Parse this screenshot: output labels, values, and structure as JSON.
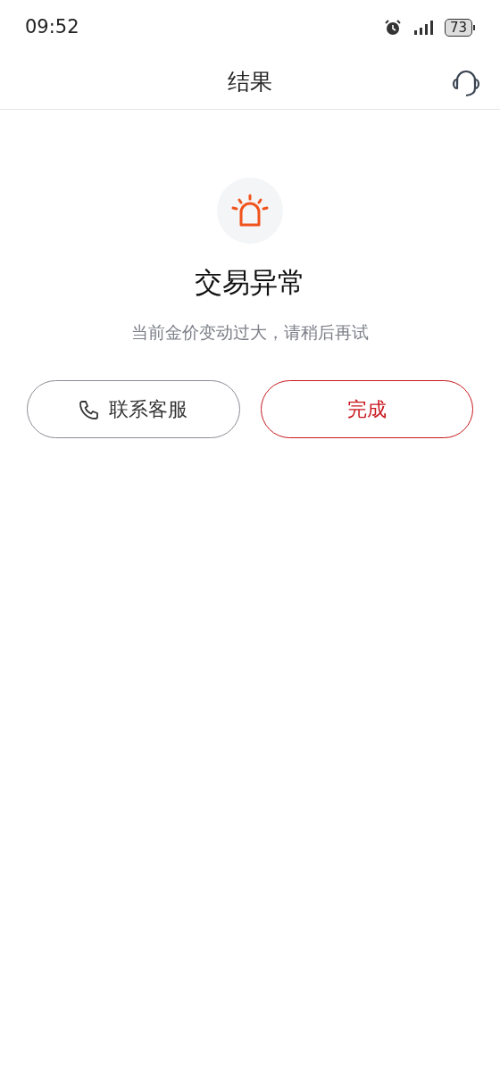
{
  "status_bar": {
    "time": "09:52",
    "battery": "73"
  },
  "header": {
    "title": "结果"
  },
  "result": {
    "title": "交易异常",
    "message": "当前金价变动过大，请稍后再试"
  },
  "buttons": [
    {
      "kind": "secondary",
      "label": "联系客服"
    },
    {
      "kind": "primary",
      "label": "完成"
    }
  ]
}
